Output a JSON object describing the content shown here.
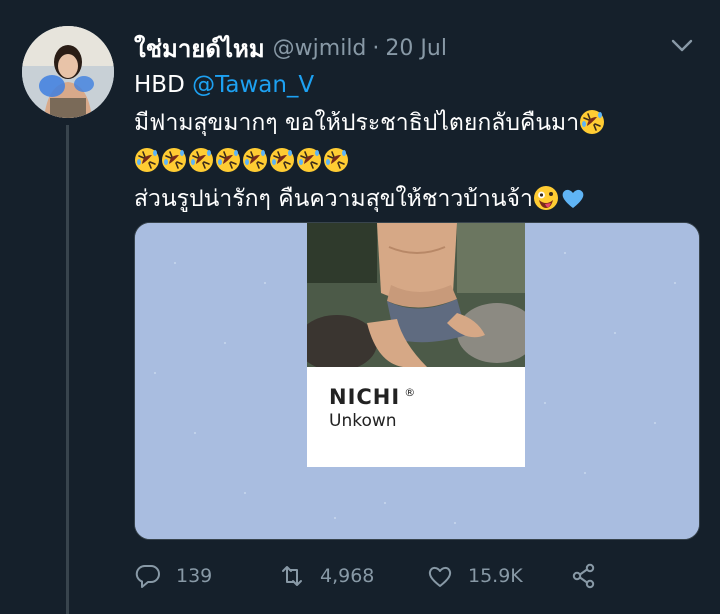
{
  "tweet": {
    "display_name": "ใช่มายด์ไหม",
    "handle": "@wjmild",
    "separator": "·",
    "time": "20 Jul",
    "line1_prefix": "HBD ",
    "mention": "@Tawan_V",
    "line2": "มีฟามสุขมากๆ ขอให้ประชาธิปไตยกลับคืนมา",
    "line3_emoji_count": "8",
    "line4": "ส่วนรูปน่ารักๆ คืนความสุขให้ชาวบ้านจ้า"
  },
  "media": {
    "brand": "NICHI",
    "brand_mark": "®",
    "subtitle": "Unkown"
  },
  "actions": {
    "reply_count": "139",
    "retweet_count": "4,968",
    "like_count": "15.9K"
  },
  "icons": {
    "reply": "reply-icon",
    "retweet": "retweet-icon",
    "like": "heart-icon",
    "share": "share-icon",
    "more": "chevron-down-icon",
    "laugh": "rolling-laughing-emoji",
    "zany": "zany-face-emoji",
    "blue_heart": "blue-heart-emoji"
  },
  "colors": {
    "background": "#15202b",
    "secondary_text": "#8899a6",
    "link": "#1da1f2",
    "media_bg": "#a9bde0"
  }
}
